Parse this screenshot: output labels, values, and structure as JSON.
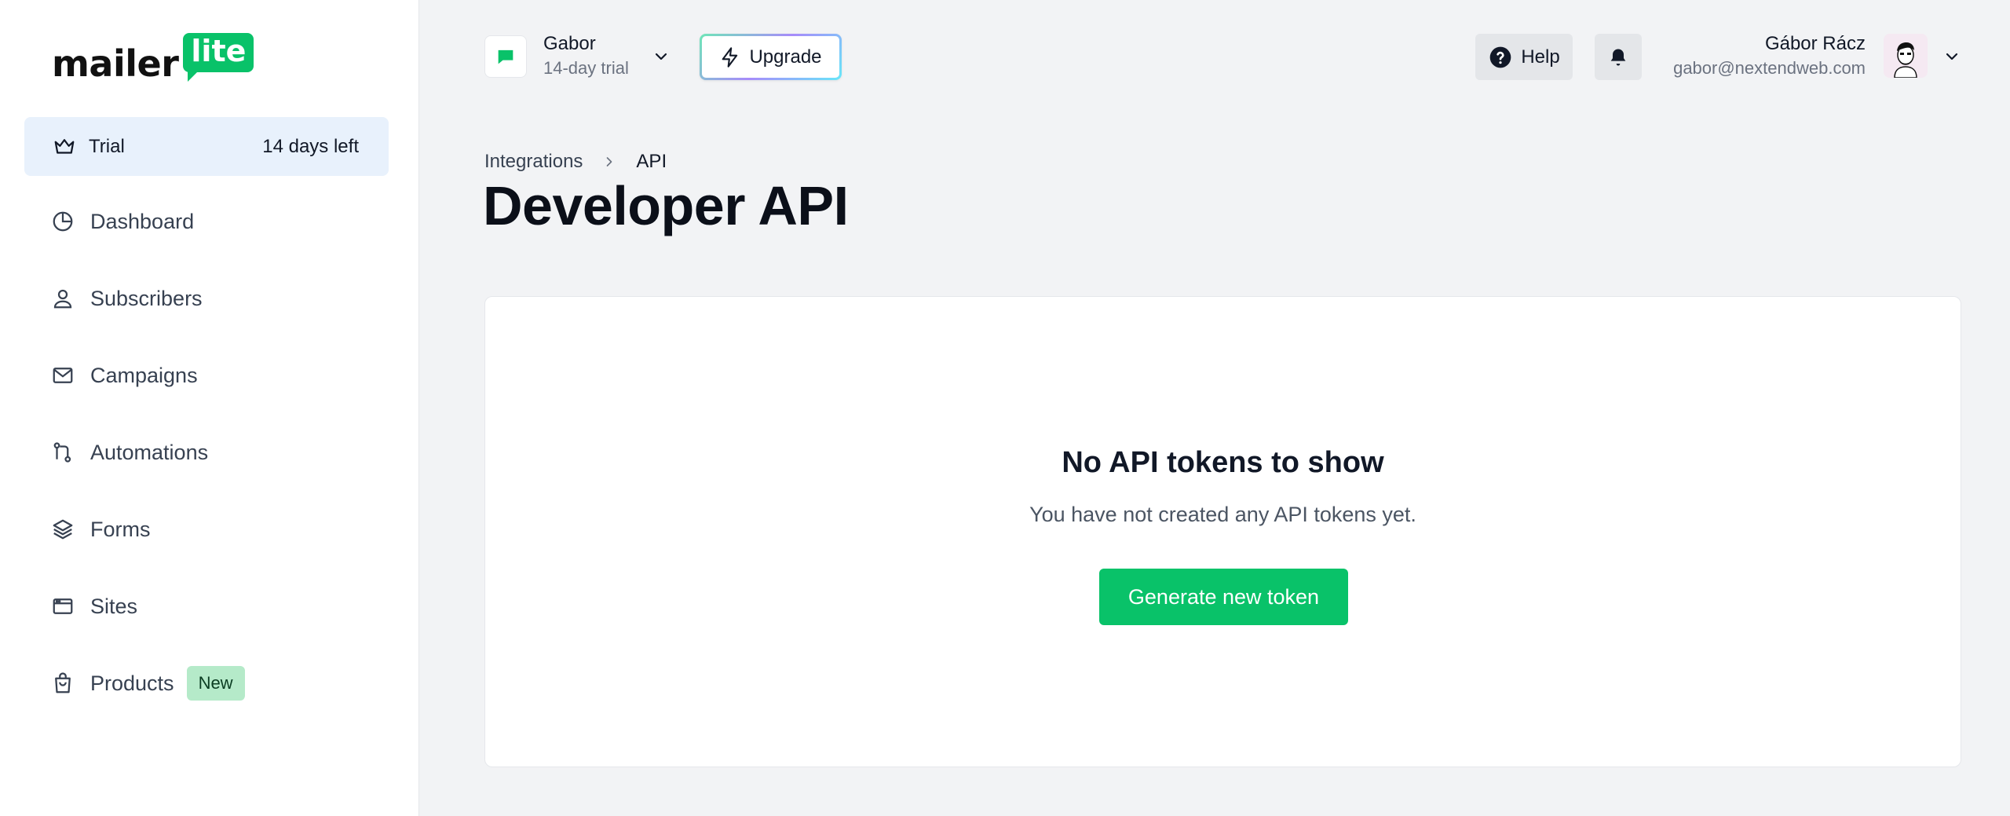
{
  "app": {
    "logo_word": "mailer",
    "logo_bubble": "lite",
    "brand_color": "#09c269"
  },
  "sidebar": {
    "trial": {
      "label": "Trial",
      "days_left": "14 days left",
      "icon": "crown-icon"
    },
    "items": [
      {
        "label": "Dashboard",
        "icon": "pie-chart-icon"
      },
      {
        "label": "Subscribers",
        "icon": "user-icon"
      },
      {
        "label": "Campaigns",
        "icon": "envelope-icon"
      },
      {
        "label": "Automations",
        "icon": "workflow-icon"
      },
      {
        "label": "Forms",
        "icon": "layers-icon"
      },
      {
        "label": "Sites",
        "icon": "browser-icon"
      },
      {
        "label": "Products",
        "icon": "shopping-bag-icon",
        "badge": "New"
      }
    ]
  },
  "header": {
    "workspace": {
      "name": "Gabor",
      "plan": "14-day trial"
    },
    "upgrade_label": "Upgrade",
    "help_label": "Help",
    "user": {
      "name": "Gábor Rácz",
      "email": "gabor@nextendweb.com"
    }
  },
  "page": {
    "breadcrumb": {
      "parent": "Integrations",
      "current": "API"
    },
    "title": "Developer API",
    "empty_state": {
      "title": "No API tokens to show",
      "subtitle": "You have not created any API tokens yet.",
      "button_label": "Generate new token"
    }
  }
}
